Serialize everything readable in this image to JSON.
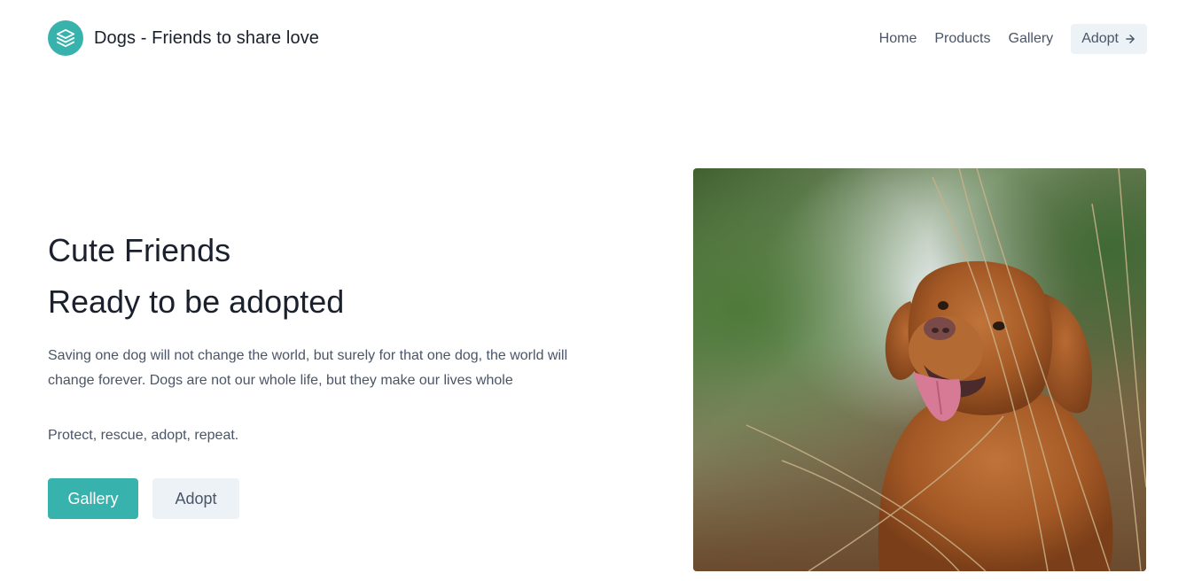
{
  "header": {
    "brand_name": "Dogs - Friends to share love",
    "logo_icon": "layers-icon",
    "nav": {
      "home": "Home",
      "products": "Products",
      "gallery": "Gallery",
      "adopt": "Adopt"
    }
  },
  "hero": {
    "title_line1": "Cute Friends",
    "title_line2": "Ready to be adopted",
    "description": "Saving one dog will not change the world, but surely for that one dog, the world will change forever. Dogs are not our whole life, but they make our lives whole",
    "tagline": "Protect, rescue, adopt, repeat.",
    "primary_button": "Gallery",
    "secondary_button": "Adopt",
    "image_icon": "dog-photo"
  },
  "colors": {
    "accent": "#38b2ac",
    "secondary_bg": "#edf2f7",
    "text_dark": "#1a202c",
    "text_muted": "#4a5568"
  }
}
